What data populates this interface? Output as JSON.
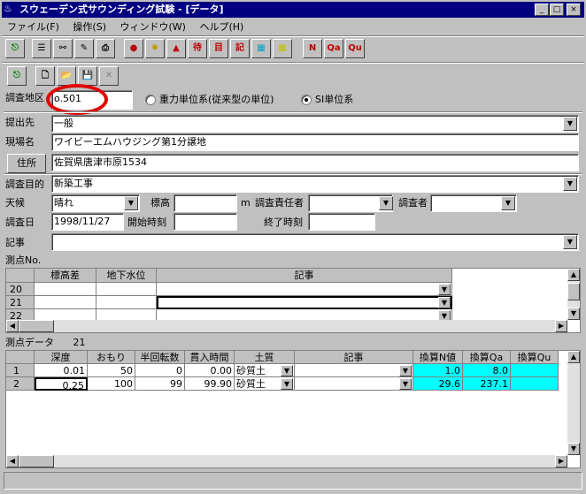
{
  "window": {
    "title": "スウェーデン式サウンディング試験 - [データ]",
    "min": "_",
    "max": "□",
    "close": "×"
  },
  "menu": [
    "ファイル(F)",
    "操作(S)",
    "ウィンドウ(W)",
    "ヘルプ(H)"
  ],
  "toolbar1": [
    "N",
    "Qa",
    "Qu"
  ],
  "toolbar1_glyphs": [
    "待",
    "目",
    "記"
  ],
  "colors": {
    "title": "#000080",
    "accent": "#00ffff",
    "highlight": "#e00000"
  },
  "survey": {
    "area_label": "調査地区",
    "area_prefix": "o.",
    "area_value": "501",
    "unit_gravity": "重力単位系(従来型の単位)",
    "unit_si": "SI単位系",
    "submit_label": "提出先",
    "submit_value": "一般",
    "site_label": "現場名",
    "site_value": "ワイビーエムハウジング第1分譲地",
    "address_button": "住所",
    "address_value": "佐賀県唐津市原1534",
    "purpose_label": "調査目的",
    "purpose_value": "新築工事",
    "weather_label": "天候",
    "weather_value": "晴れ",
    "elev_label": "標高",
    "elev_unit": "m",
    "manager_label": "調査責任者",
    "surveyor_label": "調査者",
    "date_label": "調査日",
    "date_value": "1998/11/27",
    "start_label": "開始時刻",
    "end_label": "終了時刻",
    "notes_label": "記事"
  },
  "points": {
    "title": "測点No.",
    "headers": [
      "標高差",
      "地下水位",
      "記事"
    ],
    "rows": [
      "20",
      "21",
      "22"
    ]
  },
  "data": {
    "title": "測点データ",
    "count": "21",
    "headers": [
      "深度",
      "おもり",
      "半回転数",
      "貫入時間",
      "土質",
      "記事",
      "換算N値",
      "換算Qa",
      "換算Qu"
    ],
    "rows": [
      {
        "no": "1",
        "depth": "0.01",
        "weight": "50",
        "turns": "0",
        "time": "0.00",
        "soil": "砂質土",
        "note": "",
        "n": "1.0",
        "qa": "8.0",
        "qu": ""
      },
      {
        "no": "2",
        "depth": "0.25",
        "weight": "100",
        "turns": "99",
        "time": "99.90",
        "soil": "砂質土",
        "note": "",
        "n": "29.6",
        "qa": "237.1",
        "qu": ""
      }
    ]
  }
}
